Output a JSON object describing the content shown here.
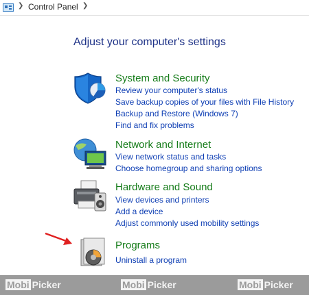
{
  "breadcrumb": {
    "item": "Control Panel"
  },
  "page_title": "Adjust your computer's settings",
  "categories": [
    {
      "title": "System and Security",
      "icon": "shield-icon",
      "links": [
        "Review your computer's status",
        "Save backup copies of your files with File History",
        "Backup and Restore (Windows 7)",
        "Find and fix problems"
      ]
    },
    {
      "title": "Network and Internet",
      "icon": "network-globe-icon",
      "links": [
        "View network status and tasks",
        "Choose homegroup and sharing options"
      ]
    },
    {
      "title": "Hardware and Sound",
      "icon": "printer-speaker-icon",
      "links": [
        "View devices and printers",
        "Add a device",
        "Adjust commonly used mobility settings"
      ]
    },
    {
      "title": "Programs",
      "icon": "programs-disc-icon",
      "links": [
        "Uninstall a program"
      ]
    }
  ],
  "watermark": {
    "box": "Mobi",
    "text": "Picker"
  },
  "colors": {
    "title": "#1e3287",
    "category": "#167c1a",
    "link": "#0f3fb4",
    "arrow": "#e02020"
  }
}
